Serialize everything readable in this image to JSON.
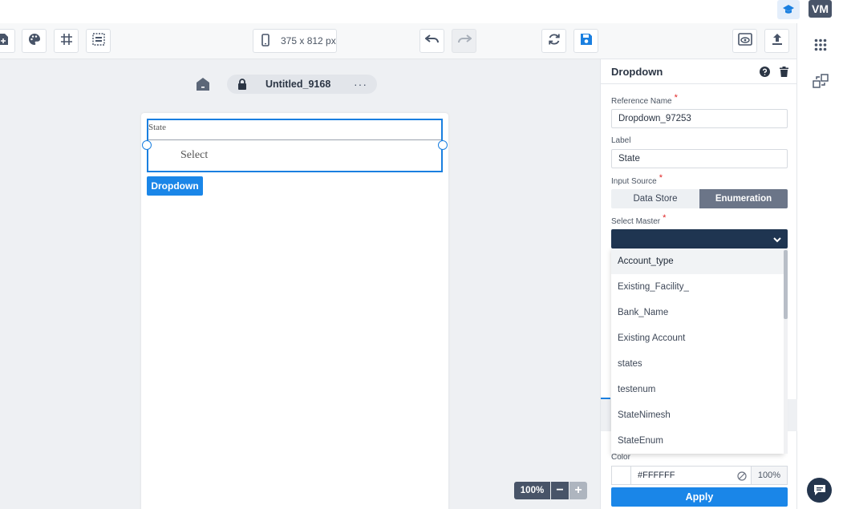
{
  "header": {
    "avatar_initials": "VM"
  },
  "toolbar": {
    "device_size": "375 x 812 px"
  },
  "canvas": {
    "page_title": "Untitled_9168",
    "more_label": "···",
    "dropdown_widget": {
      "label": "State",
      "placeholder": "Select"
    },
    "button_label": "Dropdown",
    "zoom": {
      "value": "100%",
      "minus": "−",
      "plus": "+"
    }
  },
  "panel": {
    "title": "Dropdown",
    "reference_name": {
      "label": "Reference Name",
      "required": "*",
      "value": "Dropdown_97253"
    },
    "label_field": {
      "label": "Label",
      "value": "State"
    },
    "input_source": {
      "label": "Input Source",
      "required": "*",
      "options": [
        "Data Store",
        "Enumeration"
      ],
      "selected": "Enumeration"
    },
    "select_master": {
      "label": "Select Master",
      "required": "*",
      "value": "",
      "options": [
        "Account_type",
        "Existing_Facility_",
        "Bank_Name",
        "Existing Account",
        "states",
        "testenum",
        "StateNimesh",
        "StateEnum"
      ],
      "highlighted": "Account_type"
    },
    "color": {
      "label": "Color",
      "hex": "#FFFFFF",
      "opacity": "100%"
    },
    "apply_label": "Apply"
  },
  "colors": {
    "accent": "#1a86e8",
    "select_bg": "#1f3551",
    "segment_active": "#6b7588"
  },
  "icons": [
    "graduation-cap-icon",
    "add-page-icon",
    "palette-icon",
    "grid-icon",
    "select-area-icon",
    "phone-icon",
    "undo-icon",
    "redo-icon",
    "refresh-icon",
    "save-icon",
    "preview-icon",
    "export-icon",
    "apps-grid-icon",
    "data-mapping-icon",
    "home-icon",
    "lock-icon",
    "help-icon",
    "trash-icon",
    "chevron-down-icon",
    "no-color-icon",
    "chat-icon"
  ]
}
